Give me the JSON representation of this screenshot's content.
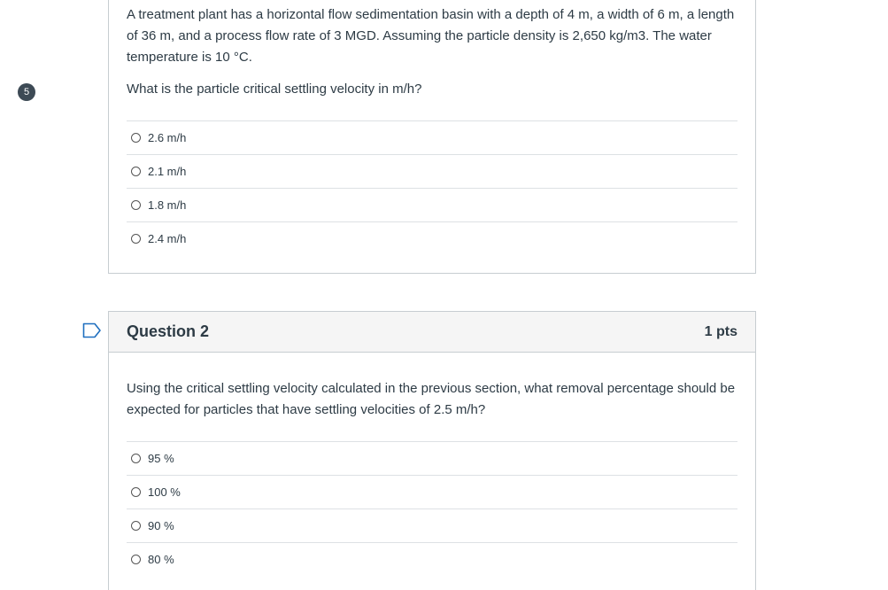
{
  "question1": {
    "number_badge": "5",
    "text_paragraph1": "A treatment plant has a horizontal flow sedimentation basin with a depth of 4 m, a width of 6 m, a length of 36 m, and a process flow rate of 3 MGD. Assuming the particle density is 2,650 kg/m3. The water temperature is 10 °C.",
    "text_paragraph2": "What is the particle critical settling velocity in m/h?",
    "answers": [
      "2.6 m/h",
      "2.1 m/h",
      "1.8 m/h",
      "2.4 m/h"
    ]
  },
  "question2": {
    "title": "Question 2",
    "points": "1 pts",
    "flag_icon": "flag-outline-icon",
    "text": "Using the critical settling velocity calculated in the previous section, what removal percentage should be expected for particles that have settling velocities of 2.5 m/h?",
    "answers": [
      "95 %",
      "100 %",
      "90 %",
      "80 %"
    ]
  },
  "colors": {
    "text": "#2d3b45",
    "border": "#c7cdd1",
    "header_bg": "#f5f5f5",
    "flag": "#1f6fbf",
    "badge": "#3d4a55"
  }
}
